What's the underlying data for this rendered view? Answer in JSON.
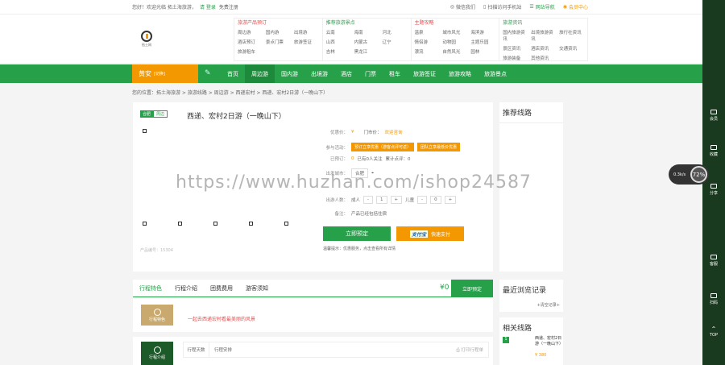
{
  "topbar": {
    "welcome": "您好！欢迎光临 拓土海旅游，",
    "login": "请 登录",
    "register": "免费注册",
    "weibo": "微信我们",
    "mobile": "扫描访问手机站",
    "sitenav": "网站导航",
    "member": "会员中心"
  },
  "logo": {
    "text": "拓土网"
  },
  "menus": [
    {
      "title": "旅游产品预订",
      "items": [
        "周边游",
        "国内游",
        "出境游",
        "酒店预订",
        "景点门票",
        "旅游签证",
        "旅游租车"
      ]
    },
    {
      "title": "推荐旅游景点",
      "items": [
        "云南",
        "海南",
        "河北",
        "山西",
        "内蒙古",
        "辽宁",
        "吉林",
        "黑龙江"
      ]
    },
    {
      "title": "主题攻略",
      "items": [
        "温泉",
        "城市风光",
        "海滨游",
        "情侣游",
        "动物园",
        "主题乐园",
        "漂流",
        "自然风光",
        "园林"
      ]
    },
    {
      "title": "旅游资讯",
      "items": [
        "国内旅游资讯",
        "出境旅游资讯",
        "旅行社资讯",
        "景区资讯",
        "酒店资讯",
        "交通资讯",
        "旅游装备",
        "其他资讯"
      ]
    }
  ],
  "nav": {
    "city": "黄安",
    "city_switch": "[切换]",
    "items": [
      "首页",
      "周边游",
      "国内游",
      "出境游",
      "酒店",
      "门票",
      "租车",
      "旅游签证",
      "旅游攻略",
      "旅游景点"
    ],
    "active": 1
  },
  "breadcrumb": "您的位置：拓土海旅游 > 旅游线路 > 周边游 > 西递宏村 > 西递、宏村2日游（一晚山下）",
  "product": {
    "tag_a": "合肥",
    "tag_b": "周边",
    "title": "西递、宏村2日游（一晚山下）",
    "image_note": "产品编号：15304",
    "price_label": "优惠价：",
    "price_value": "¥",
    "door_label": "门市价：",
    "door_value": "欢迎咨询",
    "promo_label": "参与活动：",
    "promo_a": "预订立享优惠（游客点评可返）",
    "promo_b": "团队立享最低价优惠",
    "stats_label": "已预订：",
    "stats_a": "0",
    "stats_b": "已有0人关注",
    "stats_c": "累计点评：0",
    "depart_label": "出发城市：",
    "depart_value": "合肥",
    "people_label": "出游人数：",
    "adult_label": "成人",
    "adult_count": "1",
    "child_label": "儿童",
    "child_count": "0",
    "stay_label": "备注：",
    "stay_value": "产品已经包括住宿",
    "book_btn": "立即预定",
    "pay_brand": "支付宝",
    "pay_btn": "快速支付",
    "service": "温馨提示：优惠服务，点击查看所有详情"
  },
  "sidebar": {
    "recommend_title": "推荐线路",
    "recent_title": "最近浏览记录",
    "recent_clear": "+清空记录+",
    "related_title": "相关线路",
    "related_item": "西递、宏村2日游（一晚山下）",
    "related_price": "¥ 380"
  },
  "tabs": {
    "items": [
      "行程特色",
      "行程介绍",
      "团费费用",
      "游客须知"
    ],
    "price": "¥0",
    "book": "立即预定"
  },
  "feature": {
    "icon_label": "行程特色",
    "headline": "一起去西递宏村看最美丽的风景"
  },
  "intro": {
    "icon_label": "行程介绍",
    "col_day": "行程天数",
    "col_plan": "行程安排",
    "print": "打印行程单"
  },
  "rightbar": [
    "会员",
    "收藏",
    "分享",
    "客服",
    "扫码",
    "TOP"
  ],
  "float": {
    "speed": "0.3k/s",
    "percent": "72%"
  },
  "watermark": "https://www.huzhan.com/ishop24587"
}
